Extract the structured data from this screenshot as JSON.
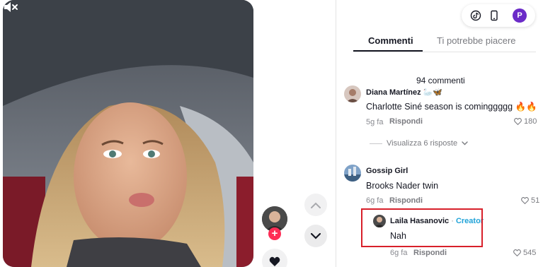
{
  "video": {
    "mute_icon": "speaker-muted-icon"
  },
  "rail": {
    "follow_symbol": "+"
  },
  "top_controls": {
    "profile_initial": "P"
  },
  "tabs": [
    {
      "label": "Commenti",
      "active": true
    },
    {
      "label": "Ti potrebbe piacere",
      "active": false
    }
  ],
  "comments_count": "94 commenti",
  "comments": [
    {
      "author": "Diana Martínez 🦢🦋",
      "text": "Charlotte Siné season is cominggggg 🔥🔥",
      "time": "5g fa",
      "reply_label": "Rispondi",
      "likes": "180",
      "view_replies": "Visualizza 6 risposte"
    },
    {
      "author": "Gossip Girl",
      "text": "Brooks Nader twin",
      "time": "6g fa",
      "reply_label": "Rispondi",
      "likes": "51",
      "replies": [
        {
          "author": "Laila Hasanovic",
          "separator": "·",
          "badge": "Creator",
          "text": "Nah",
          "time": "6g fa",
          "reply_label": "Rispondi",
          "likes": "545"
        }
      ]
    }
  ],
  "colors": {
    "accent_red": "#fe2c55",
    "creator_blue": "#20a3d8",
    "highlight_border": "#d8202a",
    "profile_purple": "#6b2bc8"
  }
}
